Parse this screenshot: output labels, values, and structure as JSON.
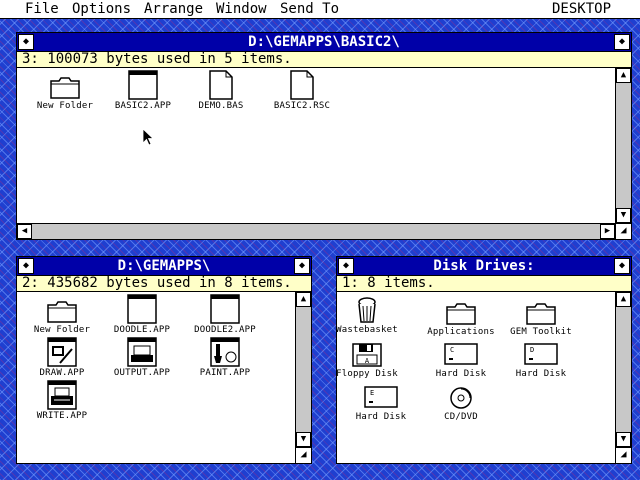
{
  "menubar": {
    "items": [
      "File",
      "Options",
      "Arrange",
      "Window",
      "Send To"
    ],
    "right_label": "DESKTOP"
  },
  "windows": {
    "basic2": {
      "title": "D:\\GEMAPPS\\BASIC2\\",
      "info": "3: 100073 bytes used in 5 items.",
      "items": [
        {
          "label": "New Folder",
          "icon": "folder-icon"
        },
        {
          "label": "BASIC2.APP",
          "icon": "app-icon"
        },
        {
          "label": "DEMO.BAS",
          "icon": "document-icon"
        },
        {
          "label": "BASIC2.RSC",
          "icon": "document-icon"
        }
      ]
    },
    "gemapps": {
      "title": "D:\\GEMAPPS\\",
      "info": "2: 435682 bytes used in 8 items.",
      "items": [
        {
          "label": "New Folder",
          "icon": "folder-icon"
        },
        {
          "label": "DOODLE.APP",
          "icon": "app-icon"
        },
        {
          "label": "DOODLE2.APP",
          "icon": "app-icon"
        },
        {
          "label": "DRAW.APP",
          "icon": "draw-app-icon"
        },
        {
          "label": "OUTPUT.APP",
          "icon": "output-app-icon"
        },
        {
          "label": "PAINT.APP",
          "icon": "paint-app-icon"
        },
        {
          "label": "WRITE.APP",
          "icon": "write-app-icon"
        }
      ]
    },
    "drives": {
      "title": "Disk Drives:",
      "info": "1: 8 items.",
      "items": [
        {
          "label": "Wastebasket",
          "icon": "wastebasket-icon"
        },
        {
          "label": "Applications",
          "icon": "folder-icon"
        },
        {
          "label": "GEM Toolkit",
          "icon": "folder-icon"
        },
        {
          "label": "Floppy Disk",
          "icon": "floppy-disk-icon",
          "letter": "A"
        },
        {
          "label": "Hard Disk",
          "icon": "hard-disk-icon",
          "letter": "C"
        },
        {
          "label": "Hard Disk",
          "icon": "hard-disk-icon",
          "letter": "D"
        },
        {
          "label": "Hard Disk",
          "icon": "hard-disk-icon",
          "letter": "E"
        },
        {
          "label": "CD/DVD",
          "icon": "cd-dvd-icon"
        }
      ]
    }
  },
  "controls": {
    "close_glyph": "◆",
    "full_glyph": "◆",
    "up_glyph": "▲",
    "down_glyph": "▼",
    "left_glyph": "◀",
    "right_glyph": "▶",
    "sizer_glyph": "◢"
  }
}
